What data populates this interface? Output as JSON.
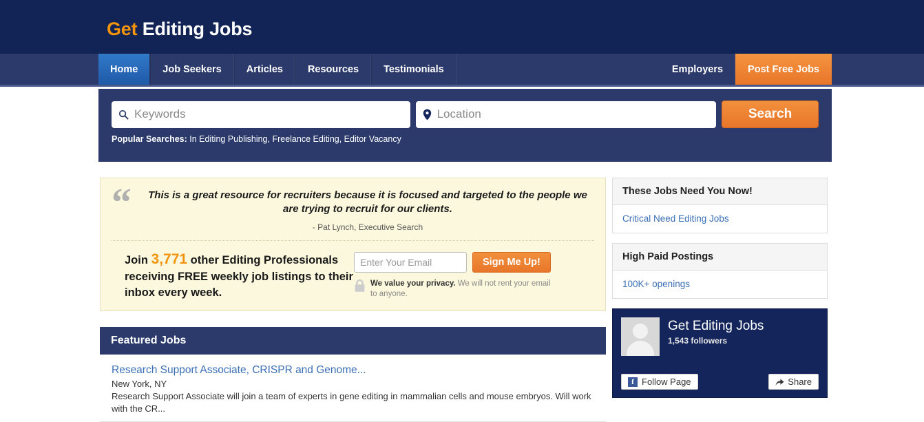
{
  "header": {
    "logo_get": "Get",
    "logo_rest": " Editing Jobs"
  },
  "nav": {
    "items": [
      {
        "label": "Home",
        "active": true
      },
      {
        "label": "Job Seekers",
        "active": false
      },
      {
        "label": "Articles",
        "active": false
      },
      {
        "label": "Resources",
        "active": false
      },
      {
        "label": "Testimonials",
        "active": false
      }
    ],
    "right_items": [
      {
        "label": "Employers",
        "cta": false
      },
      {
        "label": "Post Free Jobs",
        "cta": true
      }
    ]
  },
  "search": {
    "keywords_placeholder": "Keywords",
    "keywords_value": "",
    "location_placeholder": "Location",
    "location_value": "",
    "search_button": "Search",
    "popular_label": "Popular Searches:",
    "popular_terms": " In Editing Publishing, Freelance Editing, Editor Vacancy"
  },
  "promo": {
    "quote_mark": "“",
    "quote_text": "This is a great resource for recruiters because it is focused and targeted to the people we are trying to recruit for our clients.",
    "quote_attribution": "- Pat Lynch, Executive Search",
    "join_prefix": "Join ",
    "join_count": "3,771",
    "join_suffix": " other Editing Professionals receiving FREE weekly job listings to their inbox every week.",
    "email_placeholder": "Enter Your Email",
    "email_value": "",
    "signup_button": "Sign Me Up!",
    "privacy_bold": "We value your privacy.",
    "privacy_rest": " We will not rent your email to anyone."
  },
  "featured": {
    "title": "Featured Jobs",
    "jobs": [
      {
        "title": "Research Support Associate, CRISPR and Genome...",
        "location": "New York, NY",
        "description": "Research Support Associate will join a team of experts in gene editing in mammalian cells and mouse embryos. Will work with the CR..."
      }
    ]
  },
  "sidebar": {
    "widgets": [
      {
        "title": "These Jobs Need You Now!",
        "link": "Critical Need Editing Jobs"
      },
      {
        "title": "High Paid Postings",
        "link": "100K+ openings"
      }
    ],
    "facebook": {
      "page_name": "Get Editing Jobs",
      "followers": "1,543 followers",
      "follow_button": "Follow Page",
      "share_button": "Share"
    }
  },
  "colors": {
    "header_navy": "#122456",
    "nav_navy": "#2b3a6b",
    "accent_orange": "#e8762a",
    "logo_orange": "#f2930d",
    "link_blue": "#3b6fb6",
    "promo_cream": "#fcf8dd"
  }
}
